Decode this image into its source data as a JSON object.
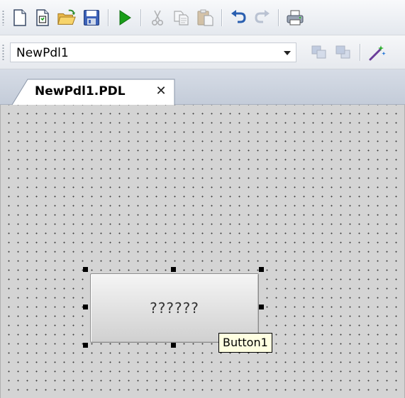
{
  "toolbar": {
    "buttons": [
      {
        "name": "new-document",
        "icon": "new-document-icon",
        "enabled": true
      },
      {
        "name": "new-file",
        "icon": "new-file-icon",
        "enabled": true
      },
      {
        "name": "open",
        "icon": "open-folder-icon",
        "enabled": true
      },
      {
        "name": "save",
        "icon": "save-icon",
        "enabled": true
      },
      {
        "name": "run",
        "icon": "play-icon",
        "enabled": true
      },
      {
        "name": "cut",
        "icon": "cut-icon",
        "enabled": false
      },
      {
        "name": "copy",
        "icon": "copy-icon",
        "enabled": false
      },
      {
        "name": "paste",
        "icon": "paste-icon",
        "enabled": false
      },
      {
        "name": "undo",
        "icon": "undo-icon",
        "enabled": true
      },
      {
        "name": "redo",
        "icon": "redo-icon",
        "enabled": false
      },
      {
        "name": "print",
        "icon": "print-icon",
        "enabled": true
      }
    ]
  },
  "toolbar2": {
    "document_select_value": "NewPdl1",
    "buttons": [
      {
        "name": "bring-forward",
        "icon": "bring-forward-icon",
        "enabled": false
      },
      {
        "name": "send-backward",
        "icon": "send-backward-icon",
        "enabled": false
      },
      {
        "name": "magic-wand",
        "icon": "magic-wand-icon",
        "enabled": true
      }
    ]
  },
  "tabs": [
    {
      "label": "NewPdl1.PDL",
      "close_symbol": "✕",
      "active": true
    }
  ],
  "canvas": {
    "background_color": "#d4d4d4",
    "grid_dot_color": "#3c3c3c",
    "selected_control": {
      "text": "??????",
      "tooltip": "Button1"
    }
  },
  "colors": {
    "play_green": "#1a9e1a",
    "undo_blue": "#2a5fb0",
    "tooltip_bg": "#ffffe1"
  }
}
